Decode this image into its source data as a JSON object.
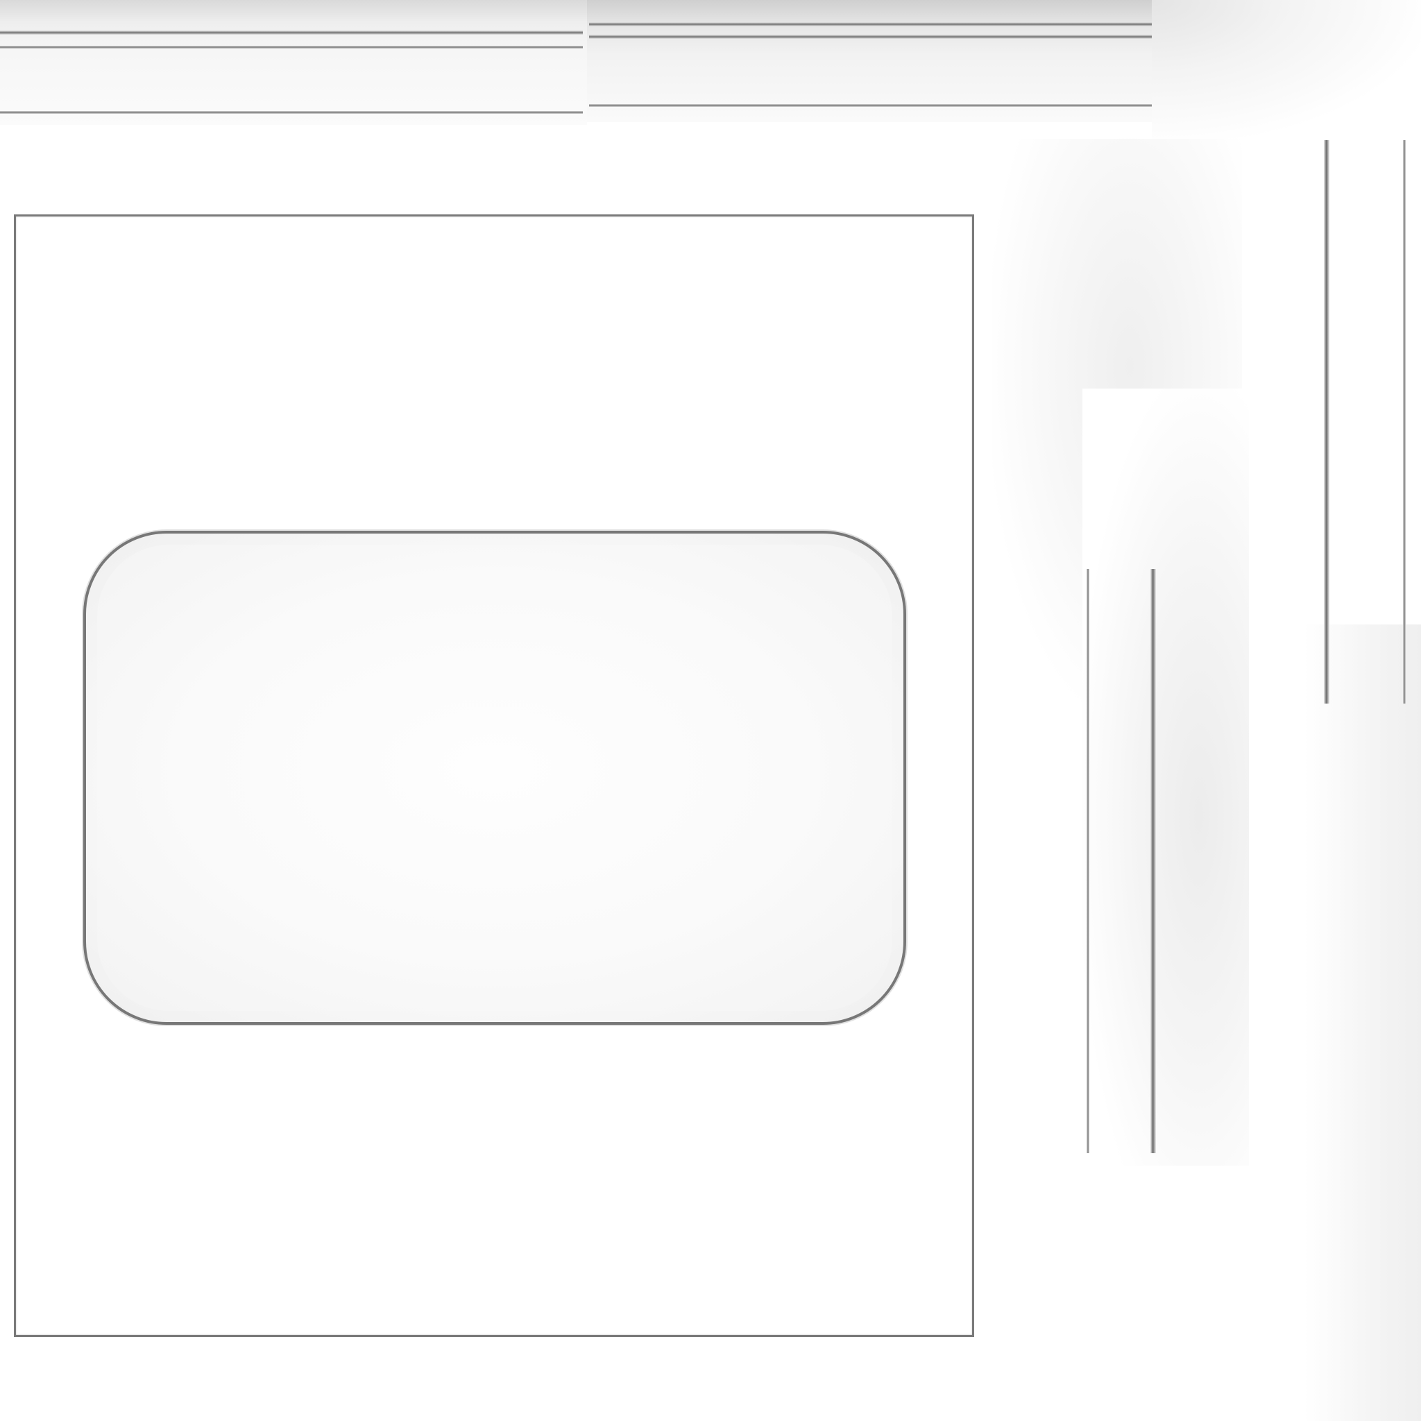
{
  "scene": {
    "description_visible_text": "",
    "background_color": "#ffffff",
    "line_color": "#777777"
  }
}
